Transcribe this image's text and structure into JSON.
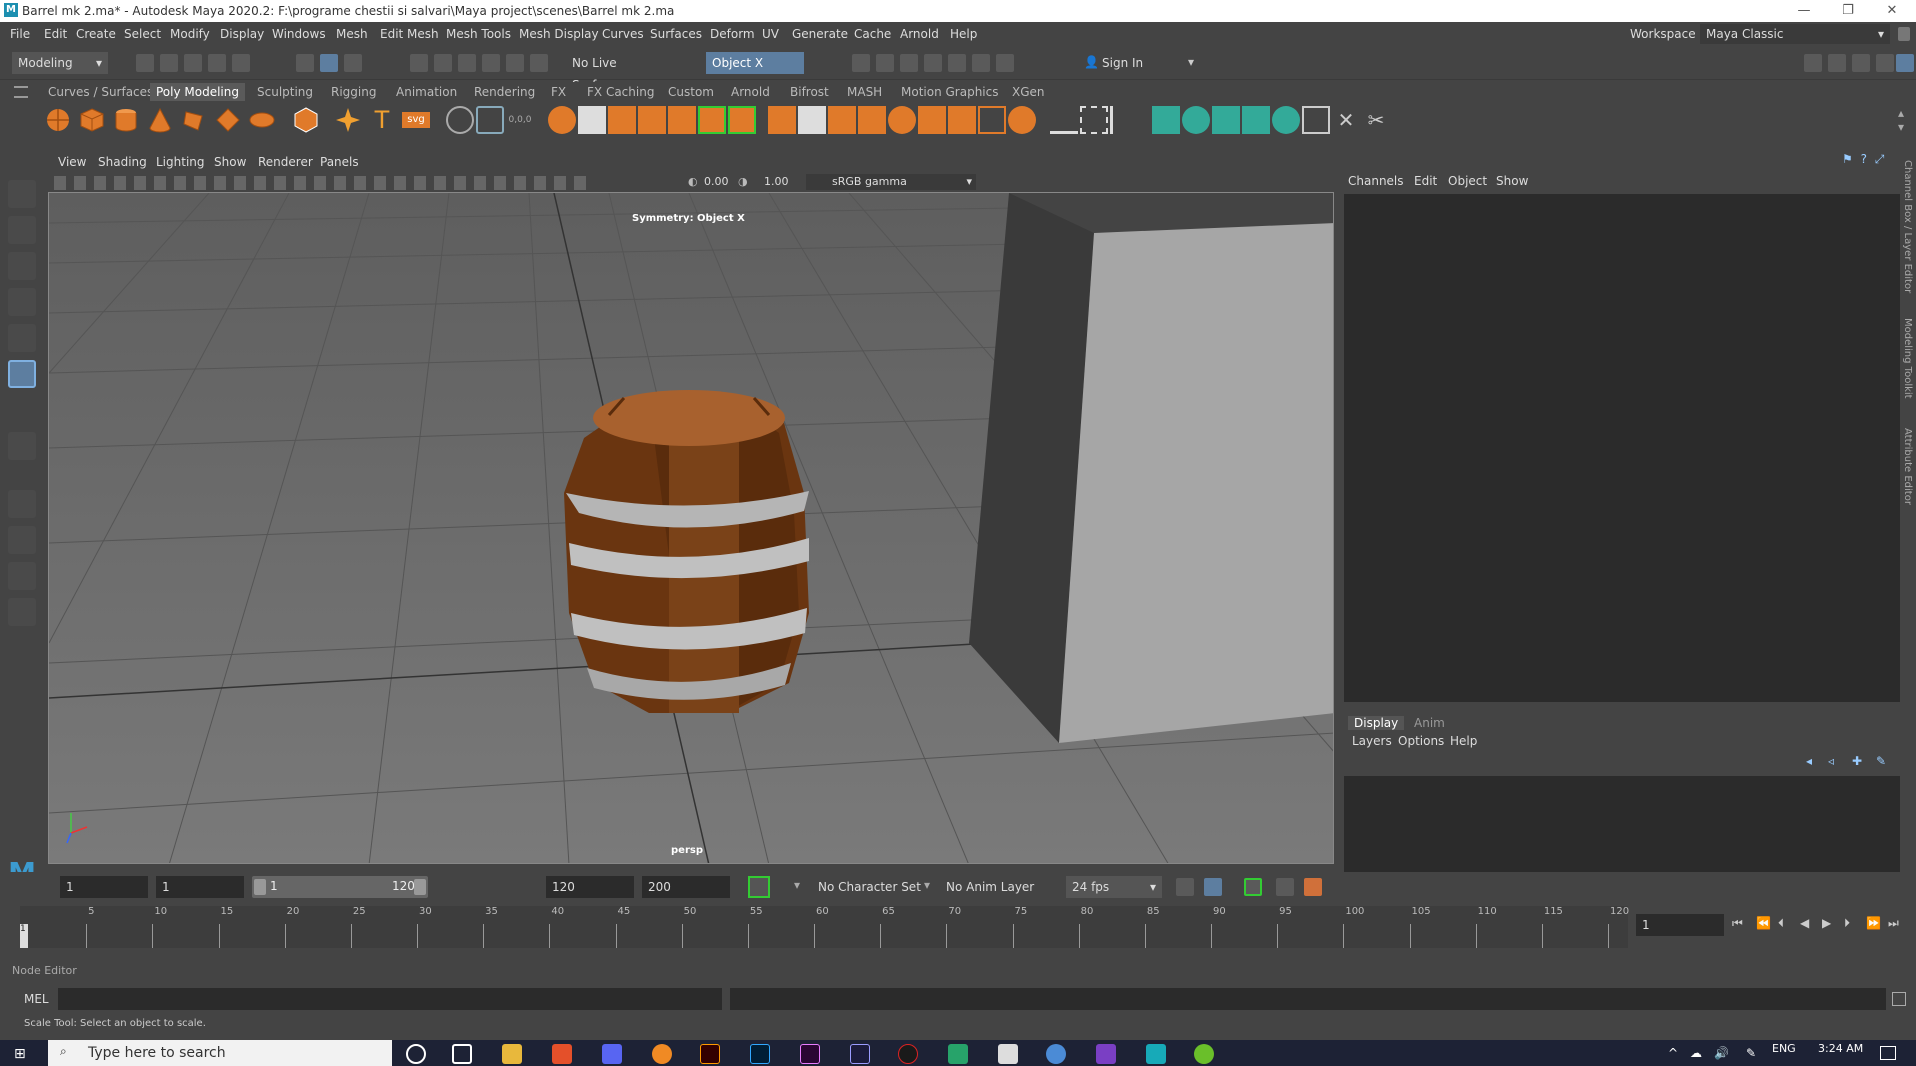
{
  "window": {
    "title": "Barrel mk 2.ma* - Autodesk Maya 2020.2: F:\\programe chestii si salvari\\Maya project\\scenes\\Barrel mk 2.ma",
    "logo_letter": "M"
  },
  "menubar": {
    "items": [
      "File",
      "Edit",
      "Create",
      "Select",
      "Modify",
      "Display",
      "Windows",
      "Mesh",
      "Edit Mesh",
      "Mesh Tools",
      "Mesh Display",
      "Curves",
      "Surfaces",
      "Deform",
      "UV",
      "Generate",
      "Cache",
      "Arnold",
      "Help"
    ],
    "workspace_label": "Workspace :",
    "workspace_value": "Maya Classic"
  },
  "statusline": {
    "mode": "Modeling",
    "live_surface": "No Live Surface",
    "symmetry": "Object X",
    "sign_in": "Sign In"
  },
  "shelf": {
    "tabs": [
      "Curves / Surfaces",
      "Poly Modeling",
      "Sculpting",
      "Rigging",
      "Animation",
      "Rendering",
      "FX",
      "FX Caching",
      "Custom",
      "Arnold",
      "Bifrost",
      "MASH",
      "Motion Graphics",
      "XGen"
    ],
    "active_tab": "Poly Modeling"
  },
  "panel": {
    "menu": [
      "View",
      "Shading",
      "Lighting",
      "Show",
      "Renderer",
      "Panels"
    ],
    "exposure": "0.00",
    "gamma": "1.00",
    "color_space": "sRGB gamma",
    "symmetry_label": "Symmetry: Object X",
    "camera_label": "persp"
  },
  "channelbox": {
    "menu": [
      "Channels",
      "Edit",
      "Object",
      "Show"
    ],
    "side_tabs": [
      "Channel Box / Layer Editor",
      "Modeling Toolkit",
      "Attribute Editor"
    ]
  },
  "layereditor": {
    "tabs": [
      "Display",
      "Anim"
    ],
    "active_tab": "Display",
    "menu": [
      "Layers",
      "Options",
      "Help"
    ]
  },
  "range": {
    "start": "1",
    "current_start": "1",
    "slider_start": "1",
    "slider_end": "120",
    "end": "120",
    "anim_end": "200",
    "character_set": "No Character Set",
    "anim_layer": "No Anim Layer",
    "fps": "24 fps",
    "current_frame": "1"
  },
  "timeline": {
    "ticks": [
      "5",
      "10",
      "15",
      "20",
      "25",
      "30",
      "35",
      "40",
      "45",
      "50",
      "55",
      "60",
      "65",
      "70",
      "75",
      "80",
      "85",
      "90",
      "95",
      "100",
      "105",
      "110",
      "115",
      "120"
    ],
    "playhead_label": "1"
  },
  "bottom": {
    "node_editor": "Node Editor",
    "mel": "MEL",
    "help_text": "Scale Tool: Select an object to scale."
  },
  "taskbar": {
    "search_placeholder": "Type here to search",
    "language": "ENG",
    "time": "3:24 AM"
  }
}
